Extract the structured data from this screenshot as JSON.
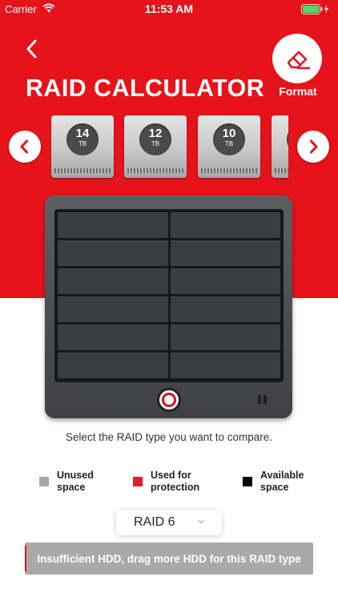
{
  "status_bar": {
    "carrier": "Carrier",
    "time": "11:53 AM"
  },
  "header": {
    "title": "RAID CALCULATOR",
    "format_label": "Format"
  },
  "drives": [
    {
      "size": "14",
      "unit": "TB"
    },
    {
      "size": "12",
      "unit": "TB"
    },
    {
      "size": "10",
      "unit": "TB"
    }
  ],
  "instruction": "Select the RAID type you want to compare.",
  "legend": [
    {
      "label": "Unused\nspace",
      "color": "#a8a8a8"
    },
    {
      "label": "Used for\nprotection",
      "color": "#e0202c"
    },
    {
      "label": "Available\nspace",
      "color": "#000000"
    }
  ],
  "raid_select": {
    "value": "RAID 6"
  },
  "warning": "Insufficient HDD, drag more HDD for this RAID type",
  "colors": {
    "brand_red": "#e6131b",
    "warning_bg": "#a9a9a9"
  }
}
